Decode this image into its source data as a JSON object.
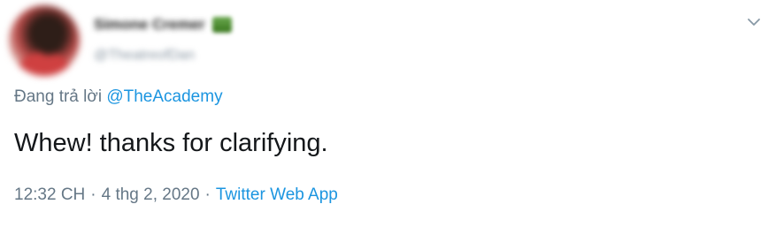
{
  "author": {
    "display_name": "Simone Cremer",
    "handle": "@TheatreofDan",
    "emoji_icon": "green-flag-emoji-icon",
    "avatar_colors": [
      "#2e1e18",
      "#cf4040"
    ]
  },
  "reply": {
    "prefix": "Đang trả lời",
    "mention": "@TheAcademy"
  },
  "tweet": {
    "text": "Whew! thanks for clarifying."
  },
  "meta": {
    "time": "12:32 CH",
    "separator": "·",
    "date": "4 thg 2, 2020",
    "source": "Twitter Web App"
  },
  "icons": {
    "more": "chevron-down-icon"
  },
  "colors": {
    "link": "#1b95e0",
    "secondary_text": "#657786",
    "primary_text": "#14171a"
  }
}
